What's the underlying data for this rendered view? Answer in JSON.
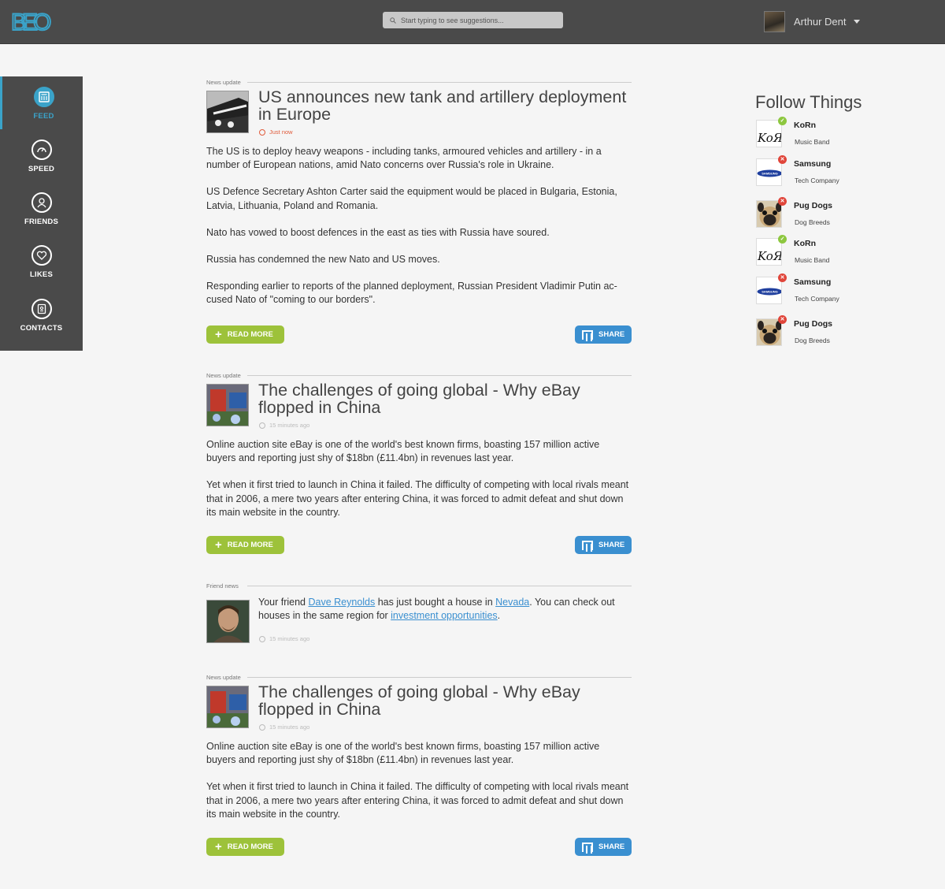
{
  "header": {
    "logo_text": "BEO",
    "search_placeholder": "Start typing to see suggestions...",
    "user_name": "Arthur Dent"
  },
  "sidebar": {
    "items": [
      {
        "label": "FEED",
        "icon": "feed-icon",
        "active": true
      },
      {
        "label": "SPEED",
        "icon": "speedometer-icon",
        "active": false
      },
      {
        "label": "FRIENDS",
        "icon": "friends-icon",
        "active": false
      },
      {
        "label": "LIKES",
        "icon": "heart-icon",
        "active": false
      },
      {
        "label": "CONTACTS",
        "icon": "contacts-icon",
        "active": false
      }
    ]
  },
  "feed": {
    "posts": [
      {
        "type": "News update",
        "title": "US announces new tank and artillery deployment in Europe",
        "time": "Just now",
        "paragraphs": [
          "The US is to deploy heavy weapons - including tanks, armoured vehicles and artillery - in a number of European nations, amid Nato concerns over Russia's role in Ukraine.",
          "US Defence Secretary Ashton Carter said the equipment would be placed in Bulgaria, Estonia, Latvia, Lithuania, Poland and Romania.",
          "Nato has vowed to boost defences in the east as ties with Russia have soured.",
          "Russia has condemned the new Nato and US moves.",
          "Responding earlier to reports of the planned deployment, Russian President Vladimir Putin ac-cused Nato of \"coming to our borders\"."
        ],
        "read_more": "READ MORE",
        "share": "SHARE"
      },
      {
        "type": "News update",
        "title": "The challenges of going global - Why eBay flopped in China",
        "time": "15 minutes ago",
        "paragraphs": [
          "Online auction site eBay is one of the world's best known firms, boasting 157 million active buyers and reporting just shy of $18bn (£11.4bn) in revenues last year.",
          "Yet when it first tried to launch in China it failed. The difficulty of competing with local rivals meant that in 2006, a mere two years after entering China, it was forced to admit defeat and shut down its main website in the country."
        ],
        "read_more": "READ MORE",
        "share": "SHARE"
      },
      {
        "type": "News update",
        "title": "The challenges of going global - Why eBay flopped in China",
        "time": "15 minutes ago",
        "paragraphs": [
          "Online auction site eBay is one of the world's best known firms, boasting 157 million active buyers and reporting just shy of $18bn (£11.4bn) in revenues last year.",
          "Yet when it first tried to launch in China it failed. The difficulty of competing with local rivals meant that in 2006, a mere two years after entering China, it was forced to admit defeat and shut down its main website in the country."
        ],
        "read_more": "READ MORE",
        "share": "SHARE"
      }
    ],
    "friend_news": {
      "type": "Friend news",
      "text_1": "Your friend ",
      "friend_link": "Dave Reynolds",
      "text_2": " has just bought a house in ",
      "place_link": "Nevada",
      "text_3": ". You can check out houses in the same region for ",
      "invest_link": "investment opportunities",
      "text_4": ".",
      "time": "15 minutes ago"
    }
  },
  "follow": {
    "title": "Follow Things",
    "items": [
      {
        "name": "KoRn",
        "category": "Music Band",
        "status": "followed",
        "logo_text": "KoЯn"
      },
      {
        "name": "Samsung",
        "category": "Tech Company",
        "status": "removable",
        "logo_text": "SAMSUNG"
      },
      {
        "name": "Pug Dogs",
        "category": "Dog Breeds",
        "status": "removable"
      },
      {
        "name": "KoRn",
        "category": "Music Band",
        "status": "followed",
        "logo_text": "KoЯn"
      },
      {
        "name": "Samsung",
        "category": "Tech Company",
        "status": "removable",
        "logo_text": "SAMSUNG"
      },
      {
        "name": "Pug Dogs",
        "category": "Dog Breeds",
        "status": "removable"
      }
    ],
    "badge_followed": "✓",
    "badge_removable": "✕"
  },
  "colors": {
    "accent": "#3aa3c9",
    "read_more": "#9dc23a",
    "share": "#3a8fd0",
    "topbar": "#4a4a4a"
  }
}
